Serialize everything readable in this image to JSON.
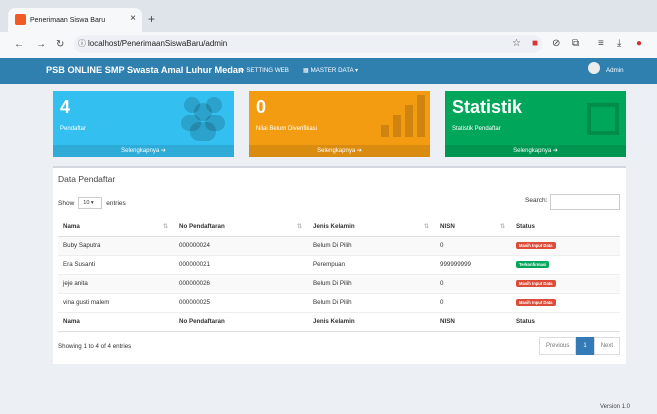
{
  "browser": {
    "tab_title": "Penerimaan Siswa Baru",
    "tab_close": "×",
    "new_tab": "+",
    "url": "localhost/PenerimaanSiswaBaru/admin"
  },
  "header": {
    "brand": "PSB ONLINE SMP Swasta Amal Luhur Medan",
    "setting_web": "SETTING WEB",
    "master_data": "MASTER DATA ▾",
    "user": "Admin"
  },
  "stats": [
    {
      "number": "4",
      "label": "Pendaftar",
      "footer": "Selengkapnya",
      "color": "#33bfef"
    },
    {
      "number": "0",
      "label": "Nilai Belum Diverifikasi",
      "footer": "Selengkapnya",
      "color": "#f39c12"
    },
    {
      "number": "Statistik",
      "label": "Statistik Pendaftar",
      "footer": "Selengkapnya",
      "color": "#00a65a"
    }
  ],
  "panel": {
    "title": "Data Pendaftar",
    "show_label": "Show",
    "entries_value": "10",
    "entries_label": "entries",
    "search_label": "Search:"
  },
  "table": {
    "columns": [
      "Nama",
      "No Pendaftaran",
      "Jenis Kelamin",
      "NISN",
      "Status"
    ],
    "rows": [
      {
        "nama": "Buby Saputra",
        "no": "000000024",
        "jk": "Belum Di Pilih",
        "nisn": "0",
        "status": "Masih Input Data",
        "status_color": "#dd4b39"
      },
      {
        "nama": "Era Susanti",
        "no": "000000021",
        "jk": "Perempuan",
        "nisn": "999999999",
        "status": "Terkonfirmasi",
        "status_color": "#00a65a"
      },
      {
        "nama": "jeje anita",
        "no": "000000026",
        "jk": "Belum Di Pilih",
        "nisn": "0",
        "status": "Masih Input Data",
        "status_color": "#dd4b39"
      },
      {
        "nama": "vina gusti malem",
        "no": "000000025",
        "jk": "Belum Di Pilih",
        "nisn": "0",
        "status": "Masih Input Data",
        "status_color": "#dd4b39"
      }
    ]
  },
  "footer": {
    "info": "Showing 1 to 4 of 4 entries",
    "previous": "Previous",
    "page": "1",
    "next": "Next",
    "version": "Version 1.0"
  }
}
